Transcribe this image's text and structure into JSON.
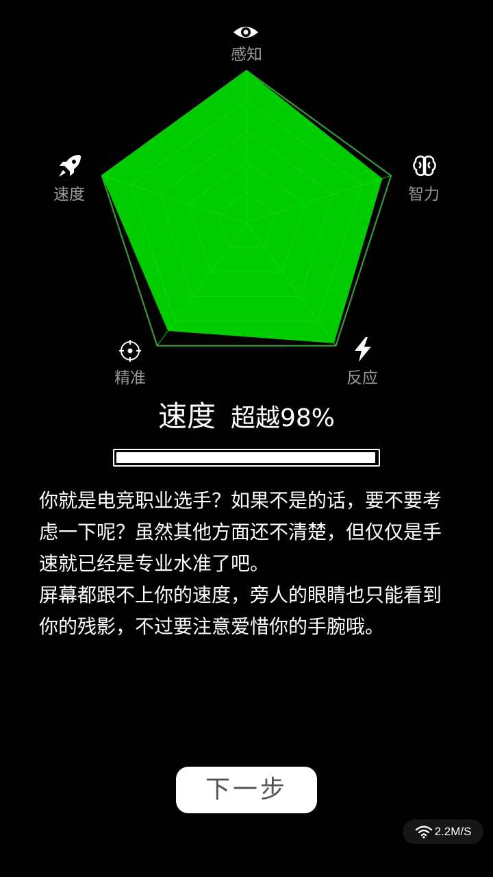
{
  "radar": {
    "axes": [
      {
        "label": "感知",
        "icon": "eye-icon",
        "value": 1.0
      },
      {
        "label": "智力",
        "icon": "brain-icon",
        "value": 0.94
      },
      {
        "label": "反应",
        "icon": "lightning-icon",
        "value": 0.98
      },
      {
        "label": "精准",
        "icon": "crosshair-icon",
        "value": 0.88
      },
      {
        "label": "速度",
        "icon": "rocket-icon",
        "value": 1.0
      }
    ],
    "rings": 5,
    "fill_color": "#00cc00",
    "grid_color": "#00e500",
    "outline_color": "#555555"
  },
  "result": {
    "skill": "速度",
    "beat_text": "超越98%",
    "progress": 0.98
  },
  "description": {
    "paragraphs": [
      "你就是电竞职业选手？如果不是的话，要不要考虑一下呢？虽然其他方面还不清楚，但仅仅是手速就已经是专业水准了吧。",
      "屏幕都跟不上你的速度，旁人的眼睛也只能看到你的残影，不过要注意爱惜你的手腕哦。"
    ]
  },
  "next_button": {
    "label": "下一步"
  },
  "status": {
    "net_speed": "2.2M/S",
    "icon": "wifi-icon"
  }
}
